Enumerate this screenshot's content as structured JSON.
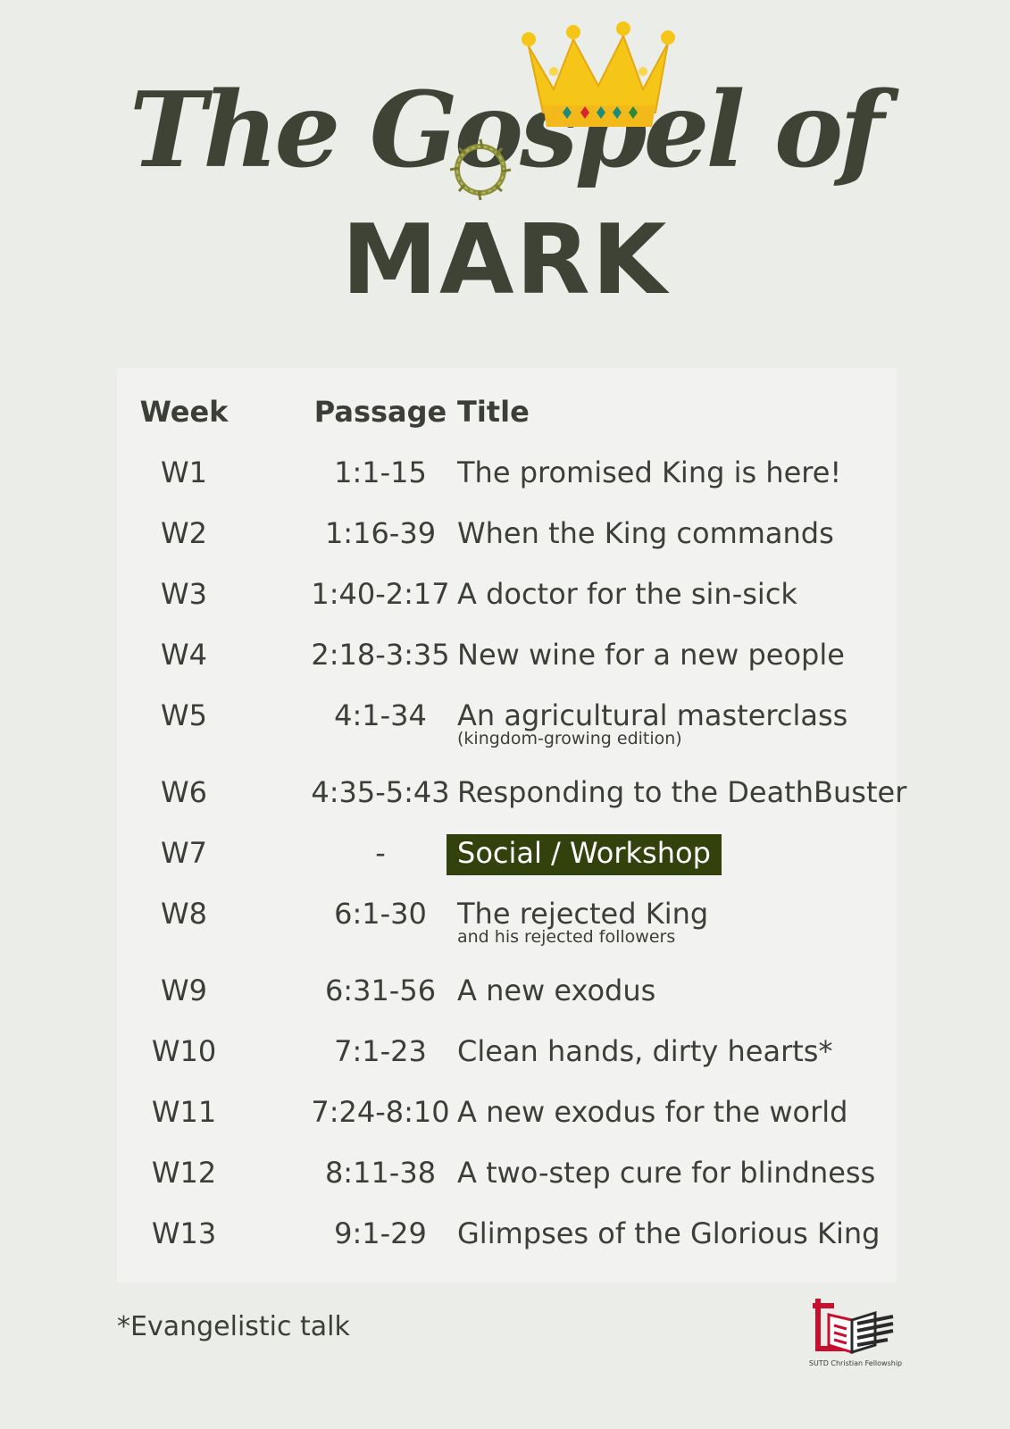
{
  "header": {
    "script_title": "The Gospel of",
    "main_title": "MARK"
  },
  "table": {
    "columns": [
      "Week",
      "Passage",
      "Title"
    ],
    "rows": [
      {
        "week": "W1",
        "passage": "1:1-15",
        "title": "The promised King is here!",
        "subtitle": ""
      },
      {
        "week": "W2",
        "passage": "1:16-39",
        "title": "When the King commands",
        "subtitle": ""
      },
      {
        "week": "W3",
        "passage": "1:40-2:17",
        "title": "A doctor for the sin-sick",
        "subtitle": ""
      },
      {
        "week": "W4",
        "passage": "2:18-3:35",
        "title": "New wine for a new people",
        "subtitle": ""
      },
      {
        "week": "W5",
        "passage": "4:1-34",
        "title": "An agricultural masterclass",
        "subtitle": "(kingdom-growing edition)"
      },
      {
        "week": "W6",
        "passage": "4:35-5:43",
        "title": "Responding to the DeathBuster",
        "subtitle": ""
      },
      {
        "week": "W7",
        "passage": "-",
        "title": "Social / Workshop",
        "subtitle": "",
        "highlighted": true
      },
      {
        "week": "W8",
        "passage": "6:1-30",
        "title": "The rejected King",
        "subtitle": "and his rejected followers"
      },
      {
        "week": "W9",
        "passage": "6:31-56",
        "title": "A new exodus",
        "subtitle": ""
      },
      {
        "week": "W10",
        "passage": "7:1-23",
        "title": "Clean hands, dirty hearts*",
        "subtitle": ""
      },
      {
        "week": "W11",
        "passage": "7:24-8:10",
        "title": "A new exodus for the world",
        "subtitle": ""
      },
      {
        "week": "W12",
        "passage": "8:11-38",
        "title": "A two-step cure for blindness",
        "subtitle": ""
      },
      {
        "week": "W13",
        "passage": "9:1-29",
        "title": "Glimpses of the Glorious King",
        "subtitle": ""
      }
    ]
  },
  "footer": {
    "note": "*Evangelistic talk",
    "org": "SUTD Christian Fellowship"
  },
  "colors": {
    "background": "#ebede8",
    "panel": "#f2f2f1",
    "text": "#3b3f37",
    "highlight": "#33410d",
    "crown": "#f5c518",
    "logo_red": "#c8102e"
  },
  "icons": [
    "crown-icon",
    "crown-of-thorns-icon",
    "open-book-cross-logo"
  ]
}
